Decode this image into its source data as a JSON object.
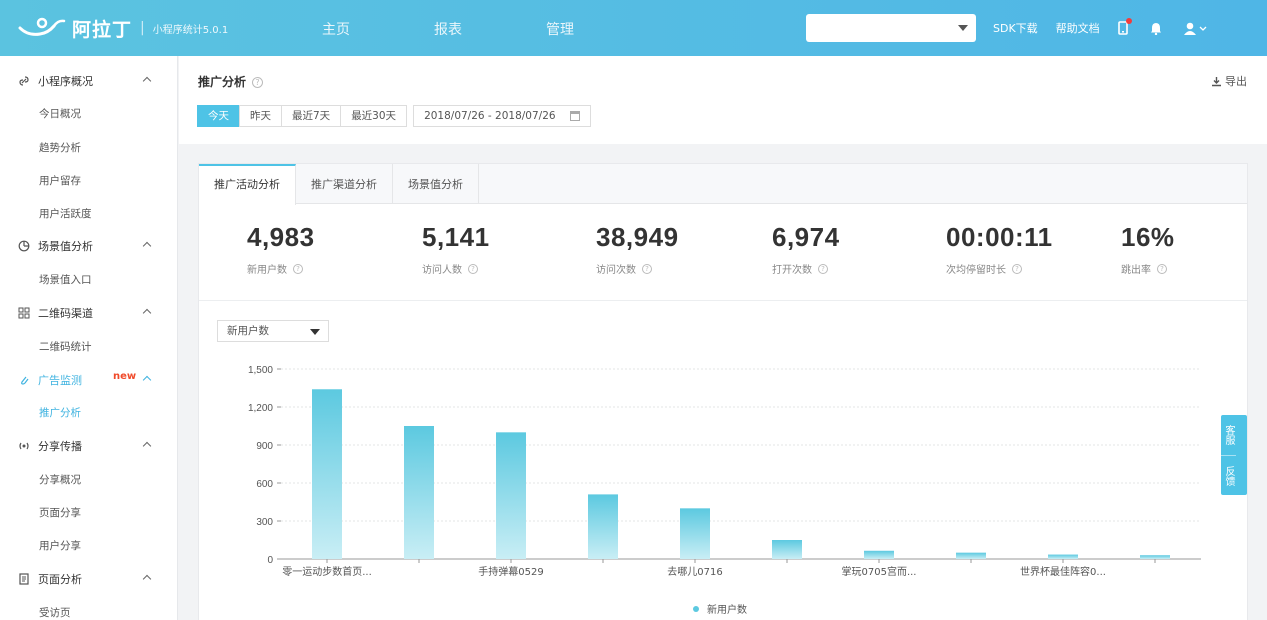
{
  "brand": {
    "name": "阿拉丁",
    "separator": "|",
    "version": "小程序统计5.0.1"
  },
  "nav": [
    {
      "label": "主页"
    },
    {
      "label": "报表"
    },
    {
      "label": "管理"
    }
  ],
  "account_selector": {
    "value": ""
  },
  "top_links": {
    "sdk": "SDK下载",
    "docs": "帮助文档"
  },
  "sidebar": [
    {
      "type": "group",
      "label": "小程序概况",
      "icon": "link-icon",
      "expanded": true
    },
    {
      "type": "item",
      "label": "今日概况"
    },
    {
      "type": "item",
      "label": "趋势分析"
    },
    {
      "type": "item",
      "label": "用户留存"
    },
    {
      "type": "item",
      "label": "用户活跃度"
    },
    {
      "type": "group",
      "label": "场景值分析",
      "icon": "pie-icon",
      "expanded": true
    },
    {
      "type": "item",
      "label": "场景值入口"
    },
    {
      "type": "group",
      "label": "二维码渠道",
      "icon": "qrcode-icon",
      "expanded": true
    },
    {
      "type": "item",
      "label": "二维码统计"
    },
    {
      "type": "group",
      "label": "广告监测",
      "icon": "clip-icon",
      "expanded": true,
      "active": true,
      "badge": "new"
    },
    {
      "type": "item",
      "label": "推广分析",
      "active": true
    },
    {
      "type": "group",
      "label": "分享传播",
      "icon": "broadcast-icon",
      "expanded": true
    },
    {
      "type": "item",
      "label": "分享概况"
    },
    {
      "type": "item",
      "label": "页面分享"
    },
    {
      "type": "item",
      "label": "用户分享"
    },
    {
      "type": "group",
      "label": "页面分析",
      "icon": "document-icon",
      "expanded": true
    },
    {
      "type": "item",
      "label": "受访页"
    }
  ],
  "page": {
    "title": "推广分析",
    "export_label": "导出",
    "date_tabs": [
      {
        "label": "今天",
        "active": true
      },
      {
        "label": "昨天"
      },
      {
        "label": "最近7天"
      },
      {
        "label": "最近30天"
      }
    ],
    "date_range": "2018/07/26 - 2018/07/26",
    "analysis_tabs": [
      {
        "label": "推广活动分析",
        "active": true
      },
      {
        "label": "推广渠道分析"
      },
      {
        "label": "场景值分析"
      }
    ],
    "metrics": [
      {
        "value": "4,983",
        "label": "新用户数"
      },
      {
        "value": "5,141",
        "label": "访问人数"
      },
      {
        "value": "38,949",
        "label": "访问次数"
      },
      {
        "value": "6,974",
        "label": "打开次数"
      },
      {
        "value": "00:00:11",
        "label": "次均停留时长"
      },
      {
        "value": "16%",
        "label": "跳出率"
      }
    ],
    "series_select": "新用户数",
    "float_service": {
      "service": "客服",
      "feedback": "反馈"
    }
  },
  "colors": {
    "topbar": "#4fb6e6",
    "accent": "#4ec3e6",
    "bar": "#5cc9e0",
    "badge": "#f04a2a"
  },
  "chart_data": {
    "type": "bar",
    "categories": [
      "零一运动步数首页...",
      "",
      "手持弹幕0529",
      "",
      "去哪儿0716",
      "",
      "掌玩0705宫而...",
      "",
      "世界杯最佳阵容0...",
      ""
    ],
    "series": [
      {
        "name": "新用户数",
        "values": [
          1340,
          1050,
          1000,
          510,
          400,
          150,
          65,
          50,
          35,
          30
        ]
      }
    ],
    "ylim": [
      0,
      1500
    ],
    "yticks": [
      "0",
      "300",
      "600",
      "900",
      "1,200",
      "1,500"
    ],
    "grid": true,
    "legend": "bottom"
  }
}
